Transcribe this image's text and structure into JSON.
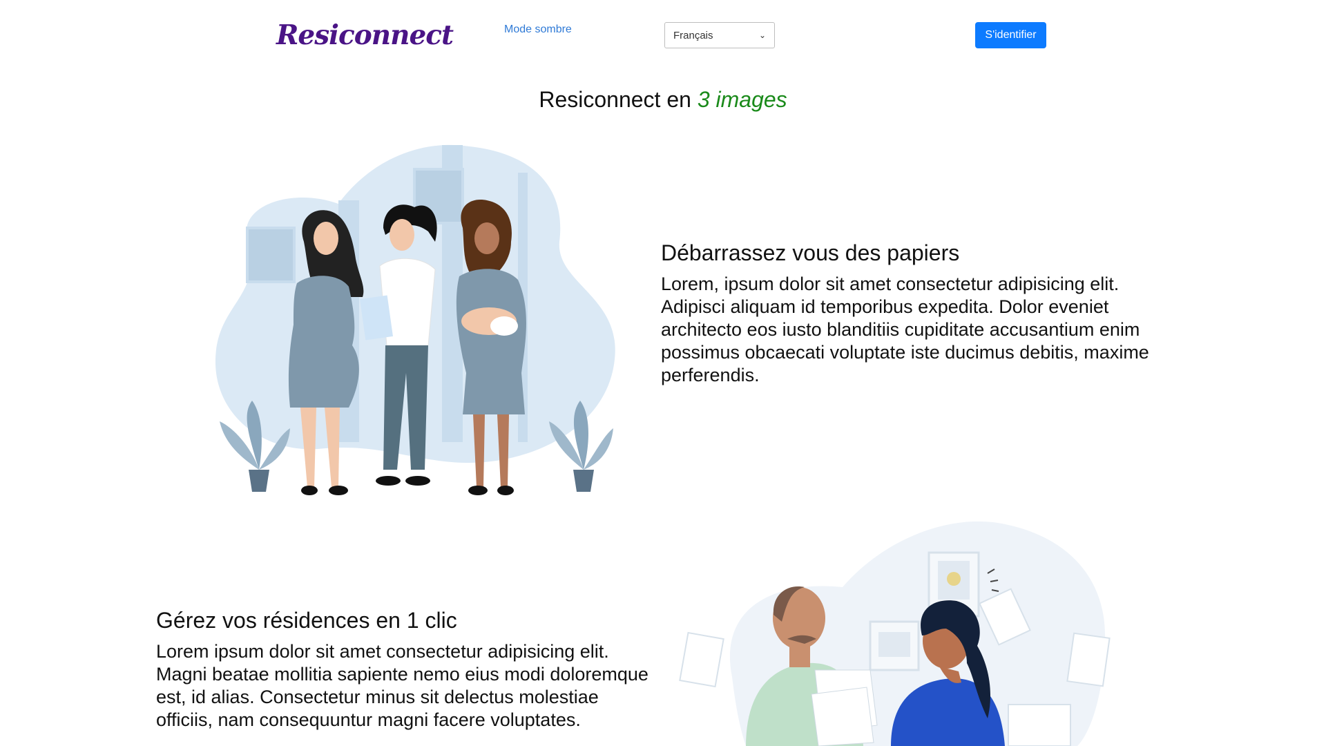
{
  "nav": {
    "logo": "Resiconnect",
    "mode_link": "Mode sombre",
    "language_select": {
      "selected": "Français"
    },
    "login_button": "S'identifier"
  },
  "hero": {
    "title_prefix": "Resiconnect en ",
    "title_accent": "3 images"
  },
  "features": [
    {
      "title": "Débarrassez vous des papiers",
      "text": "Lorem, ipsum dolor sit amet consectetur adipisicing elit. Adipisci aliquam id temporibus expedita. Dolor eveniet architecto eos iusto blanditiis cupiditate accusantium enim possimus obcaecati voluptate iste ducimus debitis, maxime perferendis."
    },
    {
      "title": "Gérez vos résidences en 1 clic",
      "text": "Lorem ipsum dolor sit amet consectetur adipisicing elit. Magni beatae mollitia sapiente nemo eius modi doloremque est, id alias. Consectetur minus sit delectus molestiae officiis, nam consequuntur magni facere voluptates."
    }
  ],
  "colors": {
    "logo": "#4a1486",
    "link": "#2f7ad6",
    "primary_button": "#0d7bff",
    "accent_green": "#1a8a1a"
  }
}
